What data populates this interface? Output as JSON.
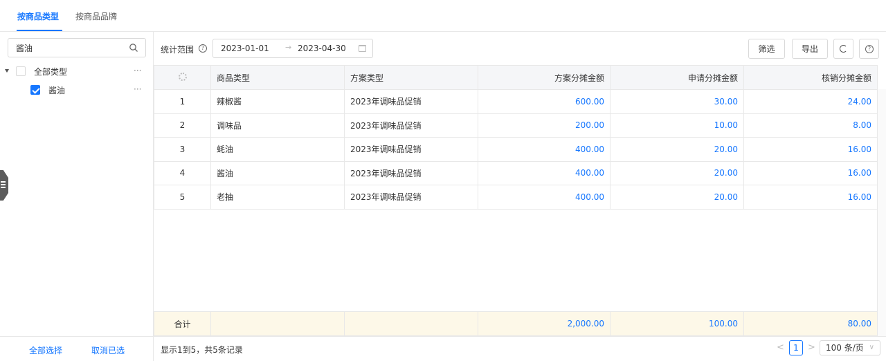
{
  "tabs": [
    {
      "label": "按商品类型",
      "active": true
    },
    {
      "label": "按商品品牌",
      "active": false
    }
  ],
  "sidebar": {
    "search_value": "酱油",
    "tree": [
      {
        "label": "全部类型",
        "checked": false,
        "more": "···"
      },
      {
        "label": "酱油",
        "checked": true,
        "more": "···"
      }
    ],
    "select_all": "全部选择",
    "deselect": "取消已选"
  },
  "toolbar": {
    "range_label": "统计范围",
    "date_start": "2023-01-01",
    "date_arrow": "→",
    "date_end": "2023-04-30",
    "filter_label": "筛选",
    "export_label": "导出",
    "refresh_icon": "refresh-icon",
    "help_icon": "help-icon"
  },
  "table": {
    "columns": [
      "商品类型",
      "方案类型",
      "方案分摊金额",
      "申请分摊金额",
      "核销分摊金额"
    ],
    "rows": [
      {
        "idx": "1",
        "type": "辣椒酱",
        "plan": "2023年调味品促销",
        "plan_amt": "600.00",
        "apply_amt": "30.00",
        "verify_amt": "24.00"
      },
      {
        "idx": "2",
        "type": "调味品",
        "plan": "2023年调味品促销",
        "plan_amt": "200.00",
        "apply_amt": "10.00",
        "verify_amt": "8.00"
      },
      {
        "idx": "3",
        "type": "蚝油",
        "plan": "2023年调味品促销",
        "plan_amt": "400.00",
        "apply_amt": "20.00",
        "verify_amt": "16.00"
      },
      {
        "idx": "4",
        "type": "酱油",
        "plan": "2023年调味品促销",
        "plan_amt": "400.00",
        "apply_amt": "20.00",
        "verify_amt": "16.00"
      },
      {
        "idx": "5",
        "type": "老抽",
        "plan": "2023年调味品促销",
        "plan_amt": "400.00",
        "apply_amt": "20.00",
        "verify_amt": "16.00"
      }
    ],
    "totals": {
      "label": "合计",
      "plan_amt": "2,000.00",
      "apply_amt": "100.00",
      "verify_amt": "80.00"
    },
    "link_color": "#1677ff",
    "total_bg": "#fdf8e8"
  },
  "status": {
    "summary": "显示1到5，共5条记录",
    "prev": "<",
    "page": "1",
    "next": ">",
    "page_size": "100 条/页"
  }
}
